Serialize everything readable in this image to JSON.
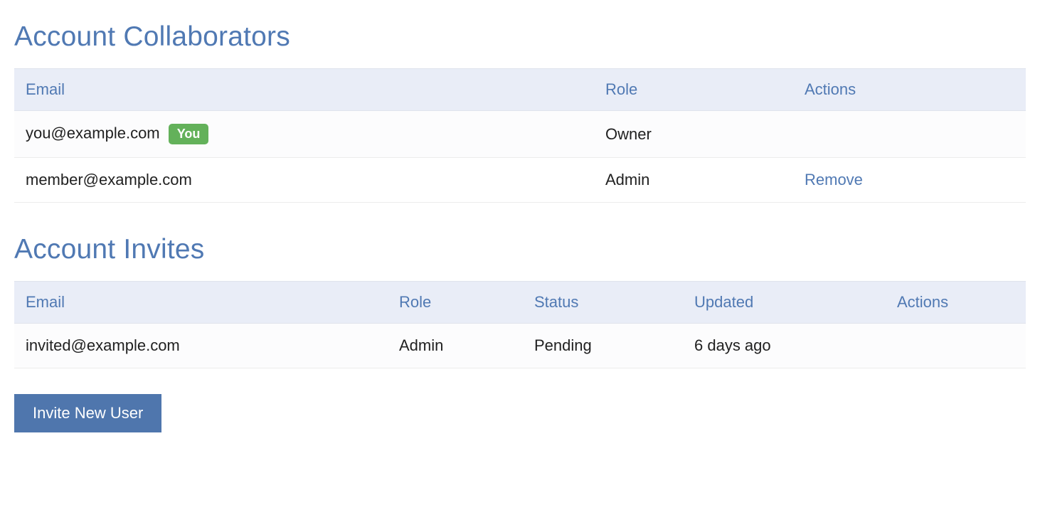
{
  "collaborators": {
    "title": "Account Collaborators",
    "headers": {
      "email": "Email",
      "role": "Role",
      "actions": "Actions"
    },
    "rows": [
      {
        "email": "you@example.com",
        "badge": "You",
        "role": "Owner",
        "action": ""
      },
      {
        "email": "member@example.com",
        "badge": "",
        "role": "Admin",
        "action": "Remove"
      }
    ]
  },
  "invites": {
    "title": "Account Invites",
    "headers": {
      "email": "Email",
      "role": "Role",
      "status": "Status",
      "updated": "Updated",
      "actions": "Actions"
    },
    "rows": [
      {
        "email": "invited@example.com",
        "role": "Admin",
        "status": "Pending",
        "updated": "6 days ago",
        "action": ""
      }
    ]
  },
  "invite_button": "Invite New User"
}
